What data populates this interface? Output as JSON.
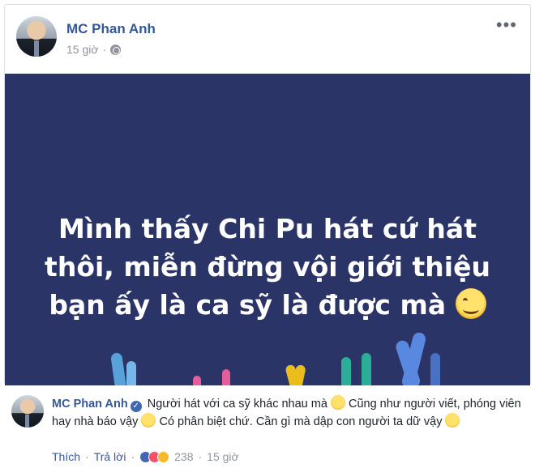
{
  "post": {
    "author": "MC Phan Anh",
    "time": "15 giờ",
    "more_label": "•••",
    "banner": {
      "line1": "Mình thấy Chi Pu hát cứ hát",
      "line2": "thôi, miễn đừng vội giới thiệu",
      "line3": "bạn ấy là ca sỹ là được mà",
      "background": "#2a3466"
    }
  },
  "comment": {
    "author": "MC Phan Anh",
    "part1": "Người hát với ca sỹ khác nhau mà",
    "part2": "Cũng như người viết, phóng viên hay nhà báo vậy",
    "part3": "Có phân biệt chứ. Cần gì mà dập con người ta dữ vậy",
    "like_label": "Thích",
    "reply_label": "Trả lời",
    "reaction_count": "238",
    "time": "15 giờ",
    "sep": "·"
  },
  "colors": {
    "link": "#365899",
    "meta": "#90949c"
  }
}
